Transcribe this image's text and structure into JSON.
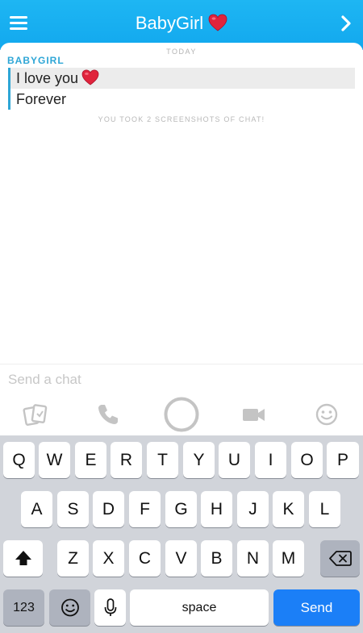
{
  "header": {
    "title": "BabyGirl"
  },
  "chat": {
    "date_label": "TODAY",
    "sender": "BABYGIRL",
    "messages": [
      {
        "text": "I love you"
      },
      {
        "text": "Forever"
      }
    ],
    "notice": "YOU TOOK 2 SCREENSHOTS OF CHAT!"
  },
  "composer": {
    "placeholder": "Send a chat"
  },
  "keyboard": {
    "row1": [
      "Q",
      "W",
      "E",
      "R",
      "T",
      "Y",
      "U",
      "I",
      "O",
      "P"
    ],
    "row2": [
      "A",
      "S",
      "D",
      "F",
      "G",
      "H",
      "J",
      "K",
      "L"
    ],
    "row3": [
      "Z",
      "X",
      "C",
      "V",
      "B",
      "N",
      "M"
    ],
    "numbers_label": "123",
    "space_label": "space",
    "send_label": "Send"
  },
  "colors": {
    "header": "#12a8ee",
    "accent": "#2ea6d6",
    "send": "#1b7ff7",
    "heart": "#e0243c"
  }
}
